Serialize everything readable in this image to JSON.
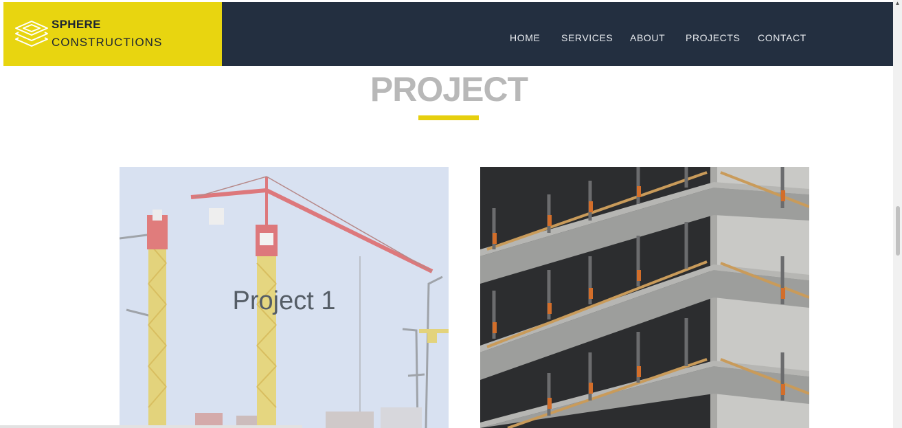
{
  "brand": {
    "line1": "SPHERE",
    "line2": "CONSTRUCTIONS"
  },
  "nav": {
    "items": [
      "HOME",
      "SERVICES",
      "ABOUT",
      "PROJECTS",
      "CONTACT"
    ]
  },
  "section": {
    "title": "PROJECT"
  },
  "projects": [
    {
      "label": "Project 1"
    },
    {
      "label": ""
    }
  ],
  "colors": {
    "header_bg": "#232f40",
    "logo_bg": "#e8d510",
    "accent": "#e6cf0e",
    "title_gray": "#b8b8b8"
  },
  "icons": {
    "logo": "stacked-layers-icon",
    "scroll_up": "scroll-up-arrow-icon"
  }
}
